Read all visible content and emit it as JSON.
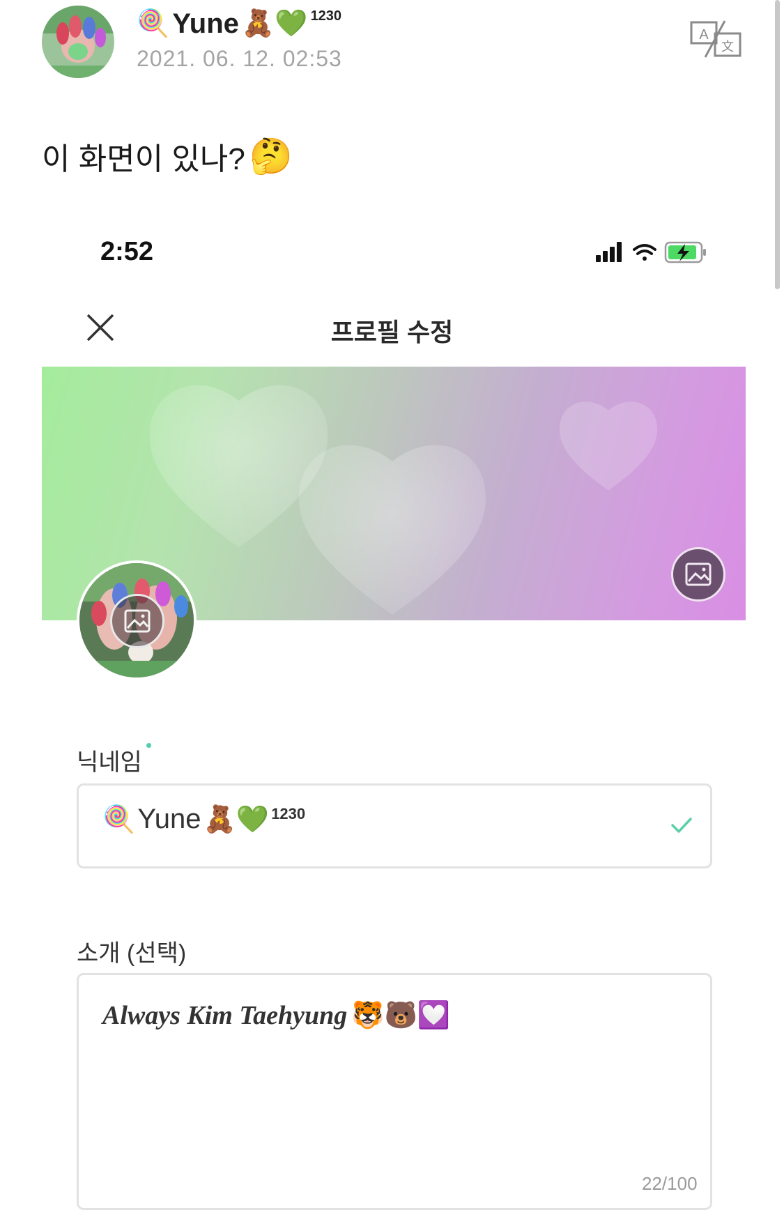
{
  "post": {
    "author_prefix_emoji": "🍭",
    "author_name": "Yune",
    "author_suffix_emoji": "🧸💚",
    "author_badge": "1230",
    "timestamp": "2021. 06. 12. 02:53",
    "text": "이 화면이 있나?",
    "text_emoji": "🤔"
  },
  "screenshot": {
    "status_time": "2:52",
    "title": "프로필 수정",
    "nickname_label": "닉네임",
    "nickname": {
      "prefix_emoji": "🍭",
      "name": "Yune",
      "suffix_emoji": "🧸💚",
      "badge": "1230"
    },
    "bio_label": "소개 (선택)",
    "bio_value": "Always Kim Taehyung",
    "bio_emoji": "🐯🐻💟",
    "bio_counter": "22/100"
  },
  "colors": {
    "cover_gradient_start": "#a4ec9c",
    "cover_gradient_end": "#d98ee4",
    "check_color": "#5ccfa8",
    "timestamp_color": "#a4a4a4"
  }
}
